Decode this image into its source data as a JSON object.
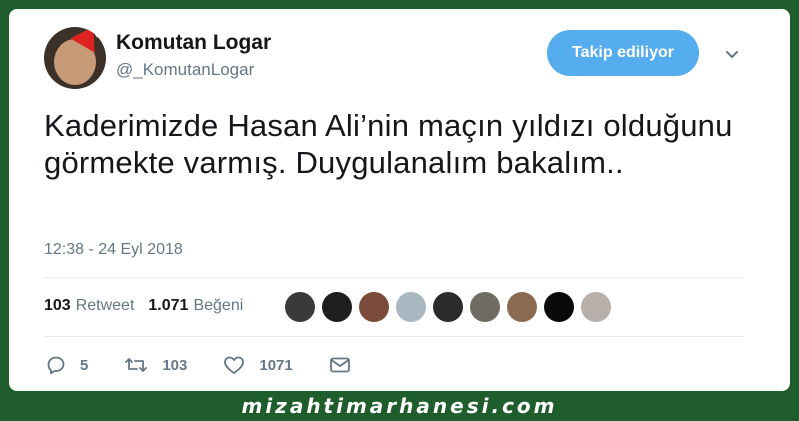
{
  "tweet": {
    "author_name": "Komutan Logar",
    "author_handle": "@_KomutanLogar",
    "follow_label": "Takip ediliyor",
    "text": "Kaderimizde Hasan Ali’nin maçın yıldızı olduğunu görmekte varmış. Duygulanalım bakalım..",
    "timestamp": "12:38 - 24 Eyl 2018"
  },
  "stats": {
    "retweet_count": "103",
    "retweet_label": "Retweet",
    "like_count": "1.071",
    "like_label": "Beğeni"
  },
  "likers": [
    {
      "color": "#3a3a3a"
    },
    {
      "color": "#1e1e1e"
    },
    {
      "color": "#7a4a3a"
    },
    {
      "color": "#aab8c2"
    },
    {
      "color": "#2b2b2b"
    },
    {
      "color": "#6f6a62"
    },
    {
      "color": "#8a6b52"
    },
    {
      "color": "#0a0a0a"
    },
    {
      "color": "#b7b0aa"
    }
  ],
  "actions": {
    "reply_count": "5",
    "retweet_count": "103",
    "like_count": "1071"
  },
  "watermark": "mizahtimarhanesi.com",
  "colors": {
    "background": "#1f5e2c",
    "accent": "#55acee",
    "text": "#14171a",
    "muted": "#657786"
  }
}
